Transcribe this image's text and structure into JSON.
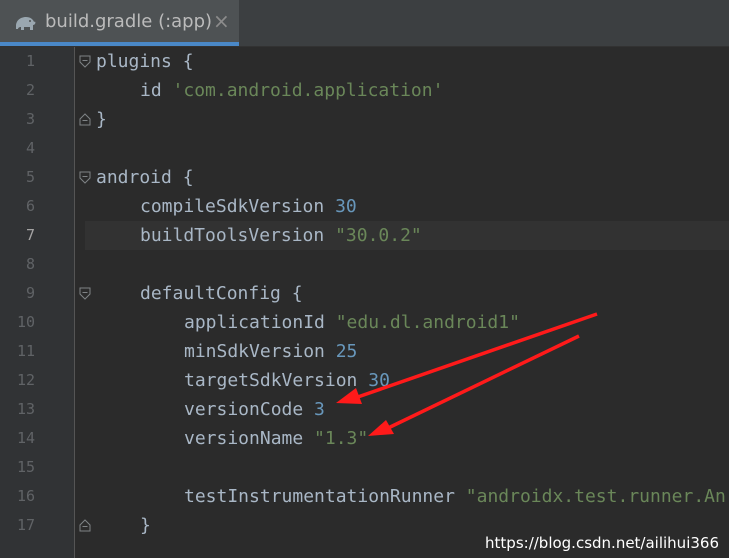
{
  "tab": {
    "title": "build.gradle (:app)",
    "icon": "gradle-elephant-icon",
    "close": "×"
  },
  "lines": [
    {
      "n": "1",
      "indent": 0,
      "parts": [
        {
          "t": "plugins {",
          "c": "plain"
        }
      ],
      "fold": "open"
    },
    {
      "n": "2",
      "indent": 1,
      "parts": [
        {
          "t": "id ",
          "c": "plain"
        },
        {
          "t": "'com.android.application'",
          "c": "str"
        }
      ]
    },
    {
      "n": "3",
      "indent": 0,
      "parts": [
        {
          "t": "}",
          "c": "plain"
        }
      ],
      "fold": "close"
    },
    {
      "n": "4",
      "indent": 0,
      "parts": []
    },
    {
      "n": "5",
      "indent": 0,
      "parts": [
        {
          "t": "android {",
          "c": "plain"
        }
      ],
      "fold": "open"
    },
    {
      "n": "6",
      "indent": 1,
      "parts": [
        {
          "t": "compileSdkVersion ",
          "c": "plain"
        },
        {
          "t": "30",
          "c": "num"
        }
      ]
    },
    {
      "n": "7",
      "indent": 1,
      "parts": [
        {
          "t": "buildToolsVersion ",
          "c": "plain"
        },
        {
          "t": "\"30.0.2\"",
          "c": "str"
        }
      ],
      "current": true
    },
    {
      "n": "8",
      "indent": 0,
      "parts": []
    },
    {
      "n": "9",
      "indent": 1,
      "parts": [
        {
          "t": "defaultConfig {",
          "c": "plain"
        }
      ],
      "fold": "open"
    },
    {
      "n": "10",
      "indent": 2,
      "parts": [
        {
          "t": "applicationId ",
          "c": "plain"
        },
        {
          "t": "\"edu.dl.android1\"",
          "c": "str"
        }
      ]
    },
    {
      "n": "11",
      "indent": 2,
      "parts": [
        {
          "t": "minSdkVersion ",
          "c": "plain"
        },
        {
          "t": "25",
          "c": "num"
        }
      ]
    },
    {
      "n": "12",
      "indent": 2,
      "parts": [
        {
          "t": "targetSdkVersion ",
          "c": "plain"
        },
        {
          "t": "30",
          "c": "num"
        }
      ]
    },
    {
      "n": "13",
      "indent": 2,
      "parts": [
        {
          "t": "versionCode ",
          "c": "plain"
        },
        {
          "t": "3",
          "c": "num"
        }
      ]
    },
    {
      "n": "14",
      "indent": 2,
      "parts": [
        {
          "t": "versionName ",
          "c": "plain"
        },
        {
          "t": "\"1.3\"",
          "c": "str"
        }
      ]
    },
    {
      "n": "15",
      "indent": 0,
      "parts": []
    },
    {
      "n": "16",
      "indent": 2,
      "parts": [
        {
          "t": "testInstrumentationRunner ",
          "c": "plain"
        },
        {
          "t": "\"androidx.test.runner.An",
          "c": "str"
        }
      ]
    },
    {
      "n": "17",
      "indent": 1,
      "parts": [
        {
          "t": "}",
          "c": "plain"
        }
      ],
      "fold": "close"
    }
  ],
  "watermark": "https://blog.csdn.net/ailihui366",
  "annotations": {
    "arrow_color": "#ff1a1a"
  },
  "colors": {
    "keyword": "#a9b7c6",
    "string": "#6a8759",
    "number": "#6897bb",
    "background": "#2b2b2b",
    "tab_accent": "#4a88c7"
  }
}
